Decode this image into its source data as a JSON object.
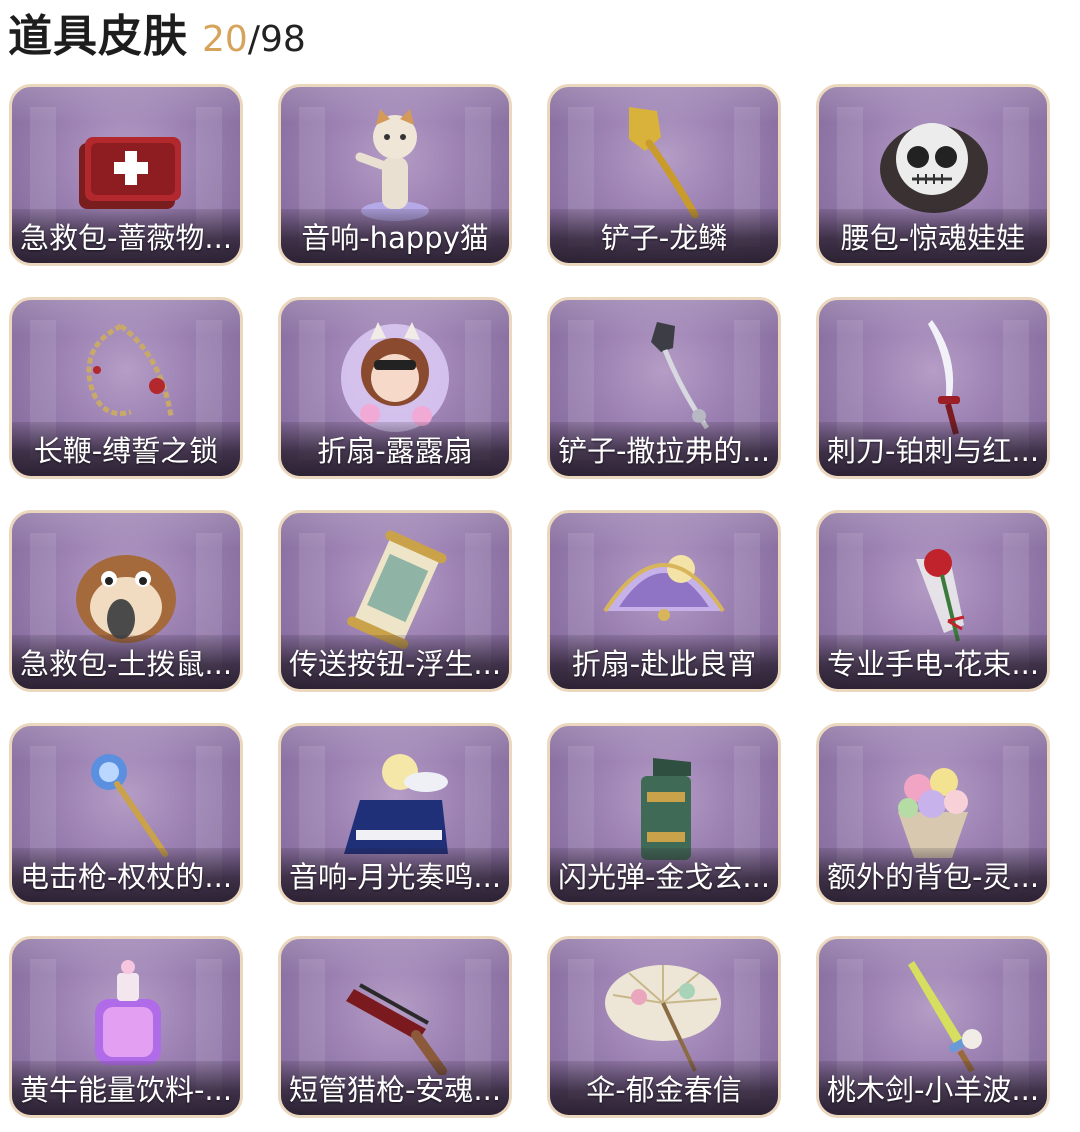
{
  "header": {
    "title": "道具皮肤",
    "owned": "20",
    "separator": "/",
    "total": "98"
  },
  "items": [
    {
      "label": "急救包-蔷薇物...",
      "icon": "first-aid-kit-icon"
    },
    {
      "label": "音响-happy猫",
      "icon": "cat-figure-icon"
    },
    {
      "label": "铲子-龙鳞",
      "icon": "golden-shovel-icon"
    },
    {
      "label": "腰包-惊魂娃娃",
      "icon": "skull-doll-icon"
    },
    {
      "label": "长鞭-缚誓之锁",
      "icon": "chain-whip-icon"
    },
    {
      "label": "折扇-露露扇",
      "icon": "anime-girl-fan-icon"
    },
    {
      "label": "铲子-撒拉弗的...",
      "icon": "ornate-shovel-icon"
    },
    {
      "label": "刺刀-铂刺与红...",
      "icon": "curved-blade-icon"
    },
    {
      "label": "急救包-土拨鼠...",
      "icon": "hamster-icon"
    },
    {
      "label": "传送按钮-浮生...",
      "icon": "scroll-icon"
    },
    {
      "label": "折扇-赴此良宵",
      "icon": "ornate-fan-icon"
    },
    {
      "label": "专业手电-花束...",
      "icon": "rose-bouquet-icon"
    },
    {
      "label": "电击枪-权杖的...",
      "icon": "scepter-icon"
    },
    {
      "label": "音响-月光奏鸣...",
      "icon": "moon-piano-icon"
    },
    {
      "label": "闪光弹-金戈玄...",
      "icon": "jade-grenade-icon"
    },
    {
      "label": "额外的背包-灵...",
      "icon": "flower-bouquet-icon"
    },
    {
      "label": "黄牛能量饮料-...",
      "icon": "crystal-bottle-icon"
    },
    {
      "label": "短管猎枪-安魂...",
      "icon": "shotgun-icon"
    },
    {
      "label": "伞-郁金春信",
      "icon": "paper-umbrella-icon"
    },
    {
      "label": "桃木剑-小羊波...",
      "icon": "wooden-sword-icon"
    }
  ]
}
